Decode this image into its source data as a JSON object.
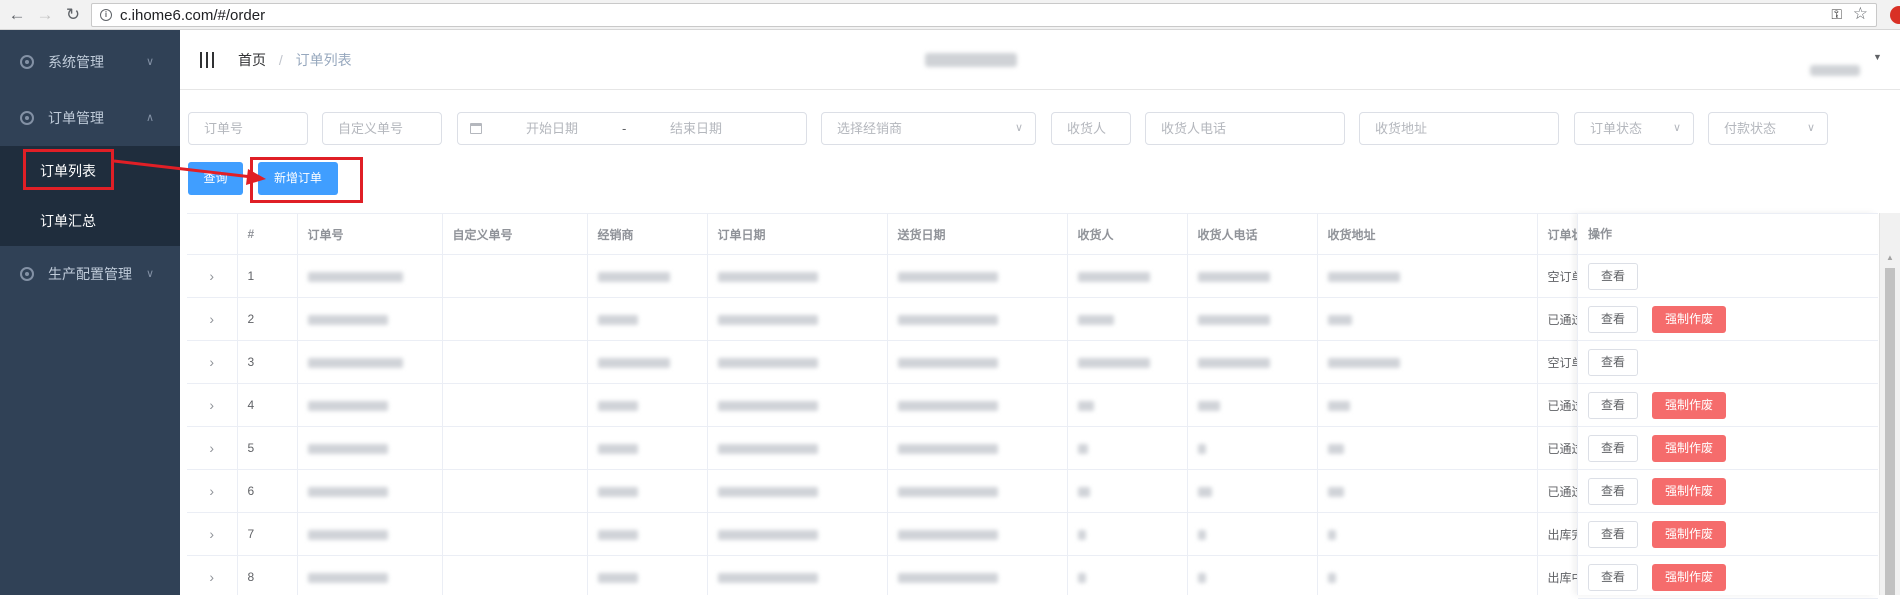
{
  "browser": {
    "url": "c.ihome6.com/#/order",
    "back_icon": "arrow-left-icon",
    "forward_icon": "arrow-right-icon",
    "reload_icon": "reload-icon"
  },
  "sidebar": {
    "background": "#304156",
    "menus": [
      {
        "label": "系统管理",
        "arrow": "∨"
      },
      {
        "label": "订单管理",
        "arrow": "∧"
      },
      {
        "label": "生产配置管理",
        "arrow": "∨"
      }
    ],
    "order_items": [
      {
        "label": "订单列表"
      },
      {
        "label": "订单汇总"
      }
    ]
  },
  "header": {
    "breadcrumb_home": "首页",
    "breadcrumb_sep": "/",
    "breadcrumb_current": "订单列表"
  },
  "filters": {
    "order_no": "订单号",
    "custom_no": "自定义单号",
    "start_date": "开始日期",
    "range_sep": "-",
    "end_date": "结束日期",
    "dealer": "选择经销商",
    "receiver": "收货人",
    "receiver_phone": "收货人电话",
    "receiver_address": "收货地址",
    "order_status": "订单状态",
    "payment_status": "付款状态"
  },
  "actions": {
    "query_label": "查询",
    "new_order_label": "新增订单",
    "primary_color": "#409eff"
  },
  "table": {
    "columns": [
      "#",
      "订单号",
      "自定义单号",
      "经销商",
      "订单日期",
      "送货日期",
      "收货人",
      "收货人电话",
      "收货地址",
      "订单状态",
      "操作"
    ],
    "status_col_header_visible": "订单状",
    "rows": [
      {
        "index": "1",
        "status": "空订单",
        "void": false
      },
      {
        "index": "2",
        "status": "已通过",
        "void": true
      },
      {
        "index": "3",
        "status": "空订单",
        "void": false
      },
      {
        "index": "4",
        "status": "已通过",
        "void": true
      },
      {
        "index": "5",
        "status": "已通过",
        "void": true
      },
      {
        "index": "6",
        "status": "已通过",
        "void": true
      },
      {
        "index": "7",
        "status": "出库完",
        "void": true
      },
      {
        "index": "8",
        "status": "出库中",
        "void": true
      }
    ],
    "view_label": "查看",
    "void_label": "强制作废",
    "void_color": "#f56c6c"
  },
  "annotation": {
    "color": "#e01f26"
  }
}
